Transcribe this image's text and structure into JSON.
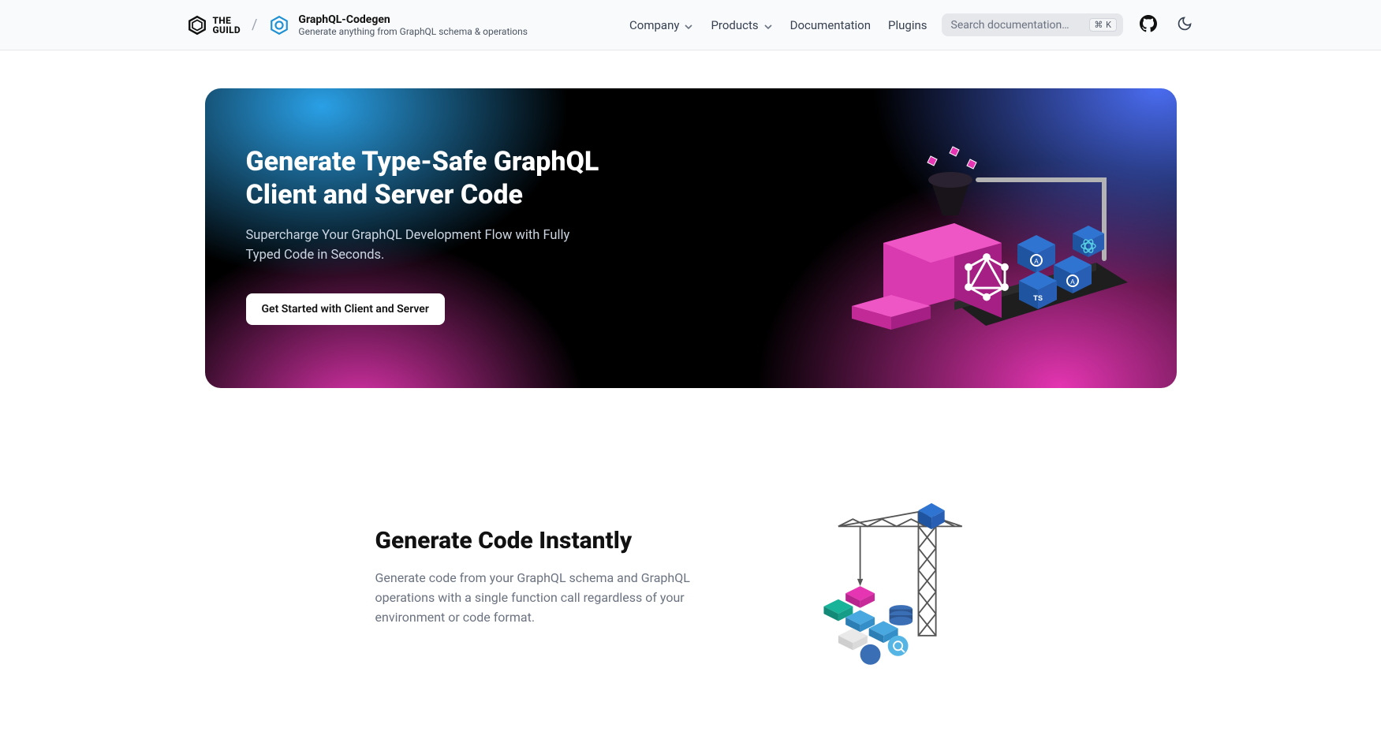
{
  "header": {
    "guild_name_line1": "THE",
    "guild_name_line2": "GUILD",
    "product_name": "GraphQL-Codegen",
    "product_tagline": "Generate anything from GraphQL schema & operations",
    "nav": {
      "company": "Company",
      "products": "Products",
      "documentation": "Documentation",
      "plugins": "Plugins"
    },
    "search_placeholder": "Search documentation…",
    "search_shortcut": "⌘ K"
  },
  "hero": {
    "title": "Generate Type-Safe GraphQL Client and Server Code",
    "subtitle": "Supercharge Your GraphQL Development Flow with Fully Typed Code in Seconds.",
    "cta": "Get Started with Client and Server"
  },
  "section2": {
    "title": "Generate Code Instantly",
    "body": "Generate code from your GraphQL schema and GraphQL operations with a single function call regardless of your environment or code format."
  }
}
